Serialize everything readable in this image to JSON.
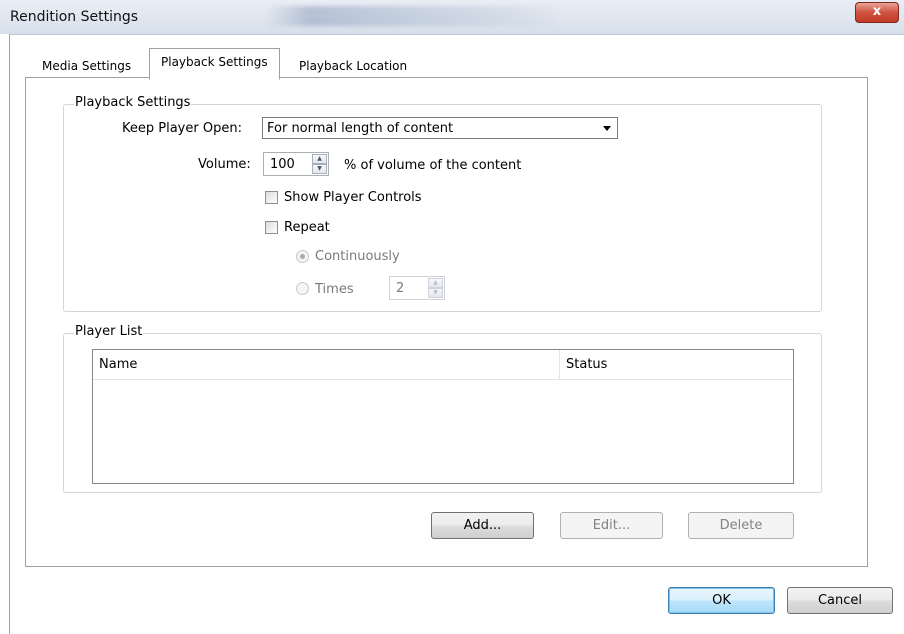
{
  "window": {
    "title": "Rendition Settings",
    "close_glyph": "x",
    "close_icon": "close-icon"
  },
  "tabs": [
    {
      "label": "Media Settings",
      "active": false
    },
    {
      "label": "Playback Settings",
      "active": true
    },
    {
      "label": "Playback Location",
      "active": false
    }
  ],
  "playback_group": {
    "legend": "Playback Settings",
    "keep_open_label": "Keep Player Open:",
    "keep_open_value": "For normal length of content",
    "volume_label": "Volume:",
    "volume_value": "100",
    "volume_suffix": "% of  volume of  the content",
    "show_controls_label": "Show Player Controls",
    "show_controls_checked": false,
    "repeat_label": "Repeat",
    "repeat_checked": false,
    "continuously_label": "Continuously",
    "continuously_selected": true,
    "times_label": "Times",
    "times_selected": false,
    "times_value": "2"
  },
  "player_list": {
    "legend": "Player List",
    "columns": [
      "Name",
      "Status"
    ],
    "rows": []
  },
  "list_buttons": {
    "add": "Add...",
    "edit": "Edit...",
    "delete": "Delete"
  },
  "footer_buttons": {
    "ok": "OK",
    "cancel": "Cancel"
  },
  "icons": {
    "spin_up": "▲",
    "spin_down": "▼"
  }
}
